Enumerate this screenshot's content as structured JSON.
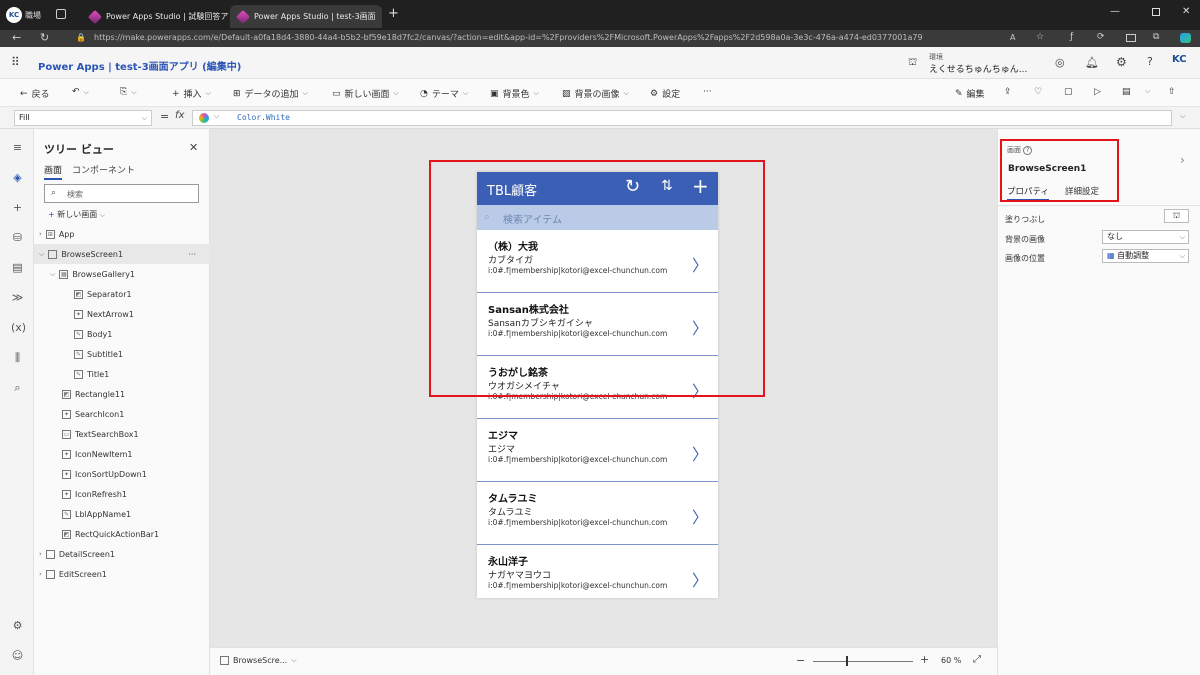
{
  "browser": {
    "profile": "KC",
    "workspace_label": "職場",
    "tabs": [
      {
        "title": "Power Apps Studio | 試験回答ア"
      },
      {
        "title": "Power Apps Studio | test-3画面"
      }
    ],
    "url": "https://make.powerapps.com/e/Default-a0fa18d4-3880-44a4-b5b2-bf59e18d7fc2/canvas/?action=edit&app-id=%2Fproviders%2FMicrosoft.PowerApps%2Fapps%2F2d598a0a-3e3c-476a-a474-ed0377001a79"
  },
  "app_header": {
    "title": "Power Apps | test-3画面アプリ (編集中)",
    "env_label": "環境",
    "env_name": "えくせるちゅんちゅん...",
    "avatar": "KC"
  },
  "commands": {
    "back": "戻る",
    "insert": "挿入",
    "add_data": "データの追加",
    "new_screen": "新しい画面",
    "theme": "テーマ",
    "bg_color": "背景色",
    "bg_image": "背景の画像",
    "settings": "設定",
    "more": "···",
    "edit": "編集"
  },
  "formula": {
    "property": "Fill",
    "fx": "fx",
    "value": "Color.White"
  },
  "tree": {
    "title": "ツリー ビュー",
    "tab_screens": "画面",
    "tab_components": "コンポーネント",
    "search_placeholder": "検索",
    "new_screen": "新しい画面",
    "nodes": [
      {
        "label": "App"
      },
      {
        "label": "BrowseScreen1"
      },
      {
        "label": "BrowseGallery1"
      },
      {
        "label": "Separator1"
      },
      {
        "label": "NextArrow1"
      },
      {
        "label": "Body1"
      },
      {
        "label": "Subtitle1"
      },
      {
        "label": "Title1"
      },
      {
        "label": "Rectangle11"
      },
      {
        "label": "SearchIcon1"
      },
      {
        "label": "TextSearchBox1"
      },
      {
        "label": "IconNewItem1"
      },
      {
        "label": "IconSortUpDown1"
      },
      {
        "label": "IconRefresh1"
      },
      {
        "label": "LblAppName1"
      },
      {
        "label": "RectQuickActionBar1"
      },
      {
        "label": "DetailScreen1"
      },
      {
        "label": "EditScreen1"
      }
    ]
  },
  "phone": {
    "title": "TBL顧客",
    "search_placeholder": "検索アイテム",
    "items": [
      {
        "title": "（株）大我",
        "subtitle": "カブタイガ",
        "body": "i:0#.f|membership|kotori@excel-chunchun.com"
      },
      {
        "title": "Sansan株式会社",
        "subtitle": "Sansanカブシキガイシャ",
        "body": "i:0#.f|membership|kotori@excel-chunchun.com"
      },
      {
        "title": "うおがし銘茶",
        "subtitle": "ウオガシメイチャ",
        "body": "i:0#.f|membership|kotori@excel-chunchun.com"
      },
      {
        "title": "エジマ",
        "subtitle": "エジマ",
        "body": "i:0#.f|membership|kotori@excel-chunchun.com"
      },
      {
        "title": "タムラユミ",
        "subtitle": "タムラユミ",
        "body": "i:0#.f|membership|kotori@excel-chunchun.com"
      },
      {
        "title": "永山洋子",
        "subtitle": "ナガヤマヨウコ",
        "body": "i:0#.f|membership|kotori@excel-chunchun.com"
      }
    ]
  },
  "status": {
    "screen": "BrowseScre...",
    "zoom": "60",
    "zoom_unit": "%",
    "zoom_level": 0.6
  },
  "props": {
    "kind": "画面",
    "name": "BrowseScreen1",
    "tab_props": "プロパティ",
    "tab_advanced": "詳細設定",
    "fill_label": "塗りつぶし",
    "bg_image_label": "背景の画像",
    "bg_image_value": "なし",
    "image_pos_label": "画像の位置",
    "image_pos_value": "自動調整"
  },
  "colors": {
    "phone_header": "#3b5fb5",
    "search_bar": "#b9cbe6",
    "highlight": "#e3141b",
    "accent": "#742774"
  }
}
